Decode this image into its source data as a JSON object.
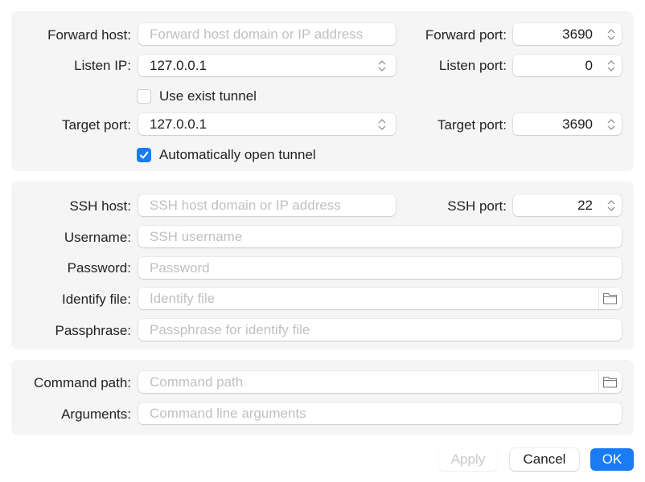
{
  "tunnel": {
    "forward_host": {
      "label": "Forward host:",
      "value": "",
      "placeholder": "Forward host domain or IP address"
    },
    "forward_port": {
      "label": "Forward port:",
      "value": "3690"
    },
    "listen_ip": {
      "label": "Listen IP:",
      "value": "127.0.0.1"
    },
    "listen_port": {
      "label": "Listen port:",
      "value": "0"
    },
    "use_exist_tunnel": {
      "label": "Use exist tunnel",
      "checked": false
    },
    "target_host": {
      "label": "Target port:",
      "value": "127.0.0.1"
    },
    "target_port": {
      "label": "Target port:",
      "value": "3690"
    },
    "auto_open": {
      "label": "Automatically open tunnel",
      "checked": true
    }
  },
  "ssh": {
    "host": {
      "label": "SSH host:",
      "value": "",
      "placeholder": "SSH host domain or IP address"
    },
    "port": {
      "label": "SSH port:",
      "value": "22"
    },
    "username": {
      "label": "Username:",
      "value": "",
      "placeholder": "SSH username"
    },
    "password": {
      "label": "Password:",
      "value": "",
      "placeholder": "Password"
    },
    "identify_file": {
      "label": "Identify file:",
      "value": "",
      "placeholder": "Identify file"
    },
    "passphrase": {
      "label": "Passphrase:",
      "value": "",
      "placeholder": "Passphrase for identify file"
    }
  },
  "command": {
    "path": {
      "label": "Command path:",
      "value": "",
      "placeholder": "Command path"
    },
    "arguments": {
      "label": "Arguments:",
      "value": "",
      "placeholder": "Command line arguments"
    }
  },
  "buttons": {
    "apply": "Apply",
    "cancel": "Cancel",
    "ok": "OK"
  },
  "icons": {
    "stepper": "up-down-chevron-icon",
    "folder": "folder-icon",
    "check": "checkmark-icon"
  },
  "colors": {
    "accent": "#1a7cf5",
    "group_bg": "#f5f5f5",
    "placeholder": "#c0c0c0"
  }
}
